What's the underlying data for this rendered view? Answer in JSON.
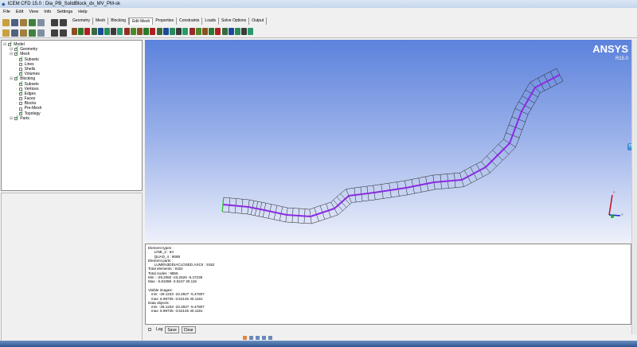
{
  "window": {
    "title": "ICEM CFD 15.0 : Dia_PB_SolidBlock_dx_MV_PM-sk"
  },
  "menu": [
    "File",
    "Edit",
    "View",
    "Info",
    "Settings",
    "Help"
  ],
  "tabs": [
    "Geometry",
    "Mesh",
    "Blocking",
    "Edit Mesh",
    "Properties",
    "Constraints",
    "Loads",
    "Solve Options",
    "Output"
  ],
  "active_tab": "Edit Mesh",
  "tree": [
    {
      "label": "Model",
      "level": 0,
      "checked": true
    },
    {
      "label": "Geometry",
      "level": 1,
      "checked": true
    },
    {
      "label": "Mesh",
      "level": 1,
      "checked": true
    },
    {
      "label": "Subsets",
      "level": 2,
      "checked": true
    },
    {
      "label": "Lines",
      "level": 2,
      "checked": false
    },
    {
      "label": "Shells",
      "level": 2,
      "checked": false
    },
    {
      "label": "Volumes",
      "level": 2,
      "checked": true
    },
    {
      "label": "Blocking",
      "level": 1,
      "checked": true
    },
    {
      "label": "Subsets",
      "level": 2,
      "checked": true
    },
    {
      "label": "Vertices",
      "level": 2,
      "checked": false
    },
    {
      "label": "Edges",
      "level": 2,
      "checked": true
    },
    {
      "label": "Faces",
      "level": 2,
      "checked": false
    },
    {
      "label": "Blocks",
      "level": 2,
      "checked": false
    },
    {
      "label": "Pre-Mesh",
      "level": 2,
      "checked": false
    },
    {
      "label": "Topology",
      "level": 2,
      "checked": true
    },
    {
      "label": "Parts",
      "level": 1,
      "checked": true
    }
  ],
  "logo": {
    "name": "ANSYS",
    "version": "R15.0"
  },
  "messages": "Element types :\n      LINE_2 : 64\n      QUAD_4 : 9088\nElement parts :\n      LUMEN3DDIACLOSED.ASCII : 9152\nTotal elements : 9152\nTotal nodes : 9856\nMin : -29.2082 -23.2626 -5.47239\nMax : 6.81088 -3.5247 40.116\n\nVisible images:\n   min: -29.1233 -23.2927 -5.47807\n   max: 6.98735 -3.52145 40.1161\nData objects:\n   min: -29.1233 -23.2927 -5.47807\n   max: 6.98735 -3.52145 40.1161",
  "msg_controls": {
    "log": "Log",
    "save": "Save",
    "clear": "Clear"
  },
  "colors": {
    "mesh_line": "#8a2be2",
    "viewport_top": "#5c82dc"
  }
}
